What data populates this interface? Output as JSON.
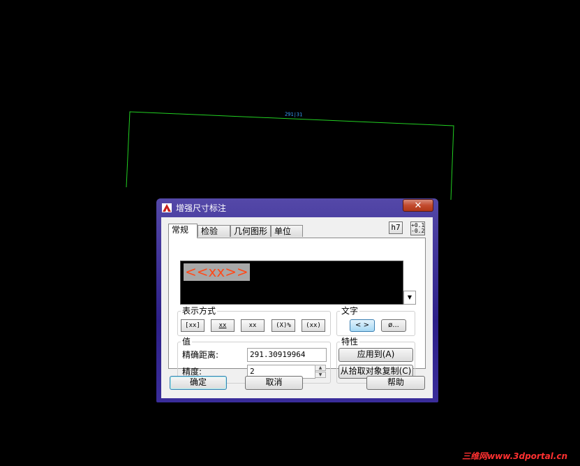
{
  "drawing": {
    "dimension_text": "291|31"
  },
  "watermark": "三维网www.3dportal.cn",
  "dialog": {
    "title": "增强尺寸标注",
    "close_glyph": "✕",
    "tabs": [
      "常规",
      "检验",
      "几何图形",
      "单位"
    ],
    "tolerance_buttons": {
      "fit": "h7",
      "deviation_top": "+0.1",
      "deviation_bottom": "-0.2"
    },
    "preview": {
      "text": "<<xx>>",
      "dropdown_glyph": "▼"
    },
    "display_mode": {
      "label": "表示方式",
      "buttons": [
        "[xx]",
        "xx",
        "xx",
        "(X)%",
        "(xx)"
      ]
    },
    "text_group": {
      "label": "文字",
      "buttons": [
        "< >",
        "ø..."
      ]
    },
    "value_group": {
      "label": "值",
      "exact_distance_label": "精确距离:",
      "exact_distance_value": "291.30919964",
      "precision_label": "精度:",
      "precision_value": "2"
    },
    "properties_group": {
      "label": "特性",
      "apply_button": "应用到(A)",
      "copy_button": "从拾取对象复制(C)"
    },
    "footer": {
      "ok": "确定",
      "cancel": "取消",
      "help": "帮助"
    }
  }
}
